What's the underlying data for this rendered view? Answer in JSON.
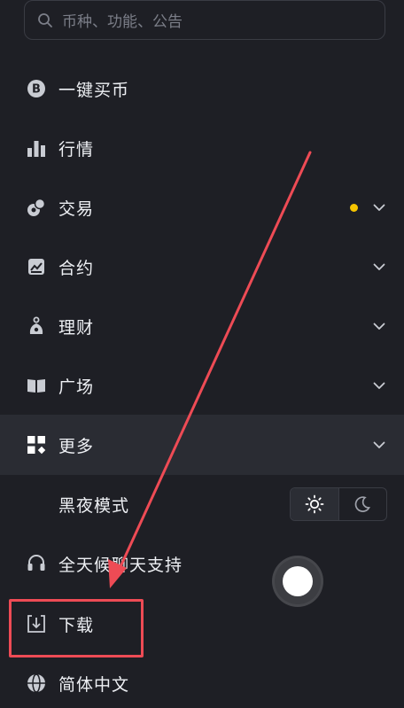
{
  "search": {
    "placeholder": "币种、功能、公告",
    "icon": "search-icon"
  },
  "menu": [
    {
      "key": "buy",
      "label": "一键买币",
      "icon": "bitcoin-icon",
      "chevron": false,
      "dot": false
    },
    {
      "key": "market",
      "label": "行情",
      "icon": "bar-chart-icon",
      "chevron": false,
      "dot": false
    },
    {
      "key": "trade",
      "label": "交易",
      "icon": "trade-icon",
      "chevron": true,
      "dot": true
    },
    {
      "key": "contract",
      "label": "合约",
      "icon": "contract-icon",
      "chevron": true,
      "dot": false
    },
    {
      "key": "finance",
      "label": "理财",
      "icon": "money-bag-icon",
      "chevron": true,
      "dot": false
    },
    {
      "key": "square",
      "label": "广场",
      "icon": "book-icon",
      "chevron": true,
      "dot": false
    },
    {
      "key": "more",
      "label": "更多",
      "icon": "grid-icon",
      "chevron": true,
      "dot": false,
      "highlighted": true
    },
    {
      "key": "night",
      "label": "黑夜模式"
    },
    {
      "key": "support",
      "label": "全天候聊天支持",
      "icon": "headset-icon"
    },
    {
      "key": "download",
      "label": "下载",
      "icon": "download-icon"
    },
    {
      "key": "language",
      "label": "简体中文",
      "icon": "globe-icon"
    }
  ],
  "theme_toggle": {
    "options": [
      "sun-icon",
      "moon-icon"
    ],
    "selected": "sun-icon"
  },
  "colors": {
    "background": "#1e1f25",
    "highlight": "#2a2c33",
    "accent_dot": "#f5c400",
    "annotation_red": "#ee4b55"
  }
}
